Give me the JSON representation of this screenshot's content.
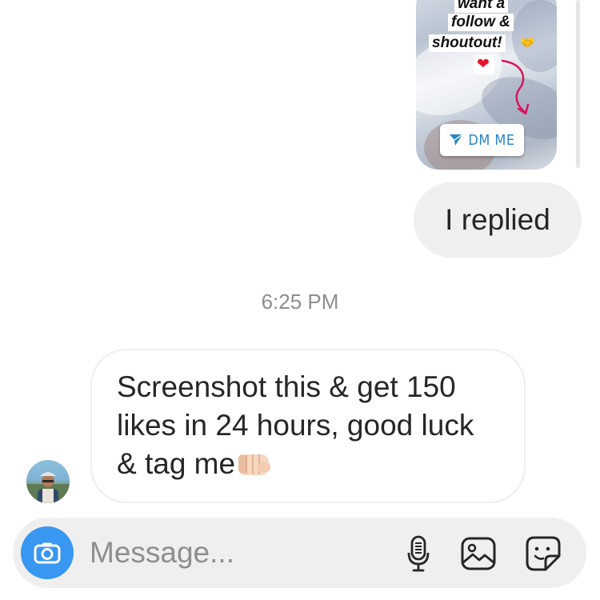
{
  "story_card": {
    "lines": [
      "want a",
      "follow &",
      "shoutout!"
    ],
    "hand_emoji": "🤝",
    "heart_emoji": "❤",
    "dm_label": "DM ME",
    "dm_icon": "paper-plane-icon"
  },
  "outgoing_message": {
    "text": "I replied"
  },
  "timestamp": "6:25 PM",
  "incoming_message": {
    "text": "Screenshot this & get 150 likes in 24 hours, good luck & tag me",
    "emoji": "fist-bump-emoji"
  },
  "composer": {
    "placeholder": "Message...",
    "icons": [
      "camera-icon",
      "microphone-icon",
      "gallery-icon",
      "sticker-icon"
    ]
  },
  "colors": {
    "accent": "#3897f0",
    "bubble_gray": "#efefef",
    "text": "#262626",
    "muted": "#8e8e8e",
    "dm_blue": "#2b86c5",
    "arrow_pink": "#d6175f"
  }
}
